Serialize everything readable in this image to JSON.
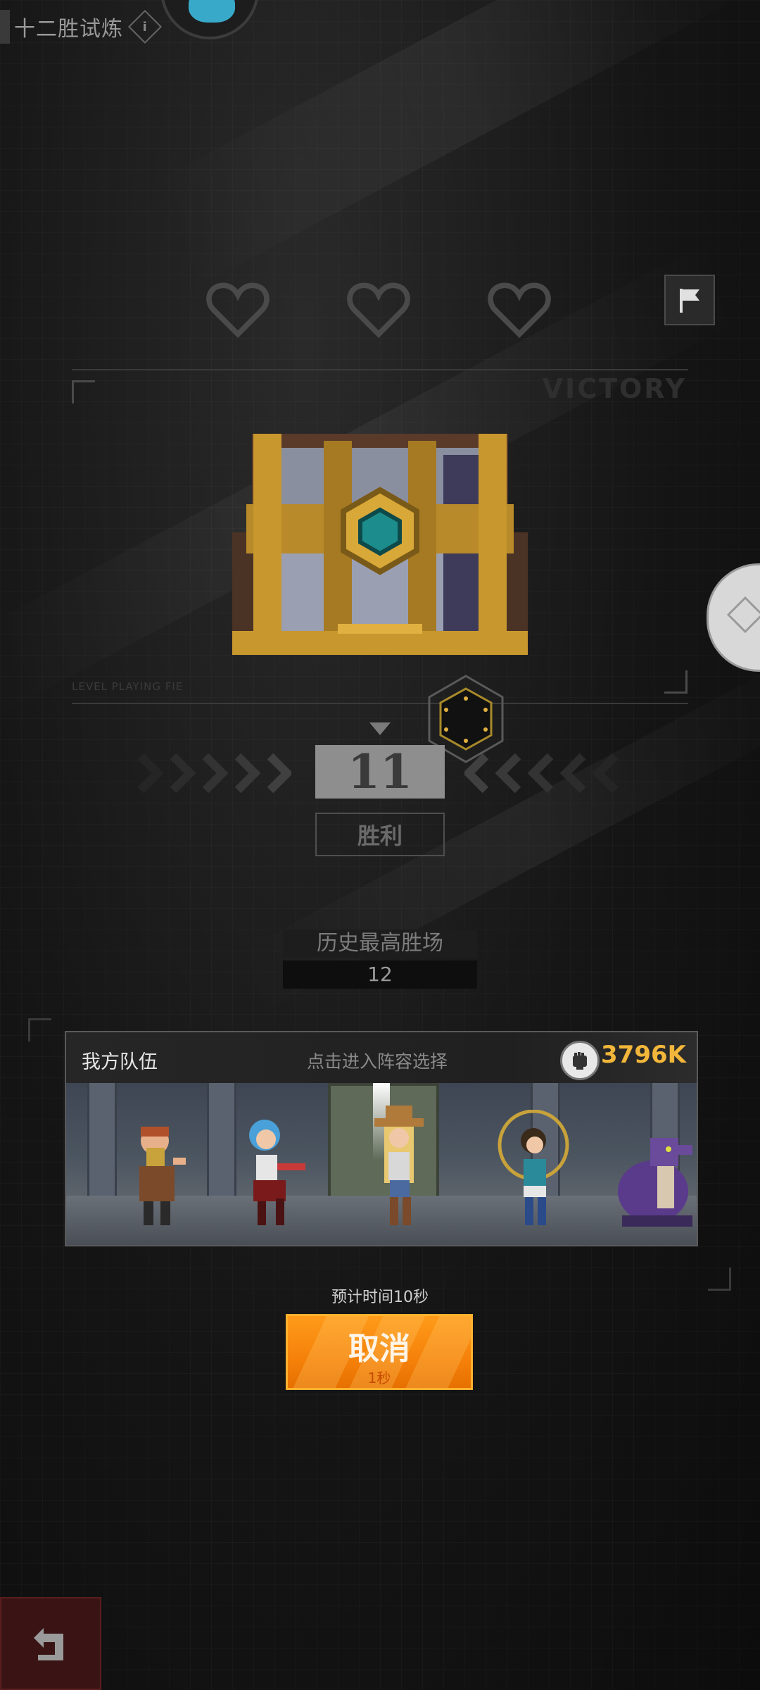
{
  "header": {
    "title": "十二胜试炼",
    "info_icon": "info-icon",
    "avatar_icon": "avatar-icon"
  },
  "lives": {
    "hearts": [
      "heart-icon",
      "heart-icon",
      "heart-icon"
    ],
    "flag_icon": "flag-icon"
  },
  "reward": {
    "victory_word": "VICTORY",
    "level_text": "LEVEL PLAYING FIE",
    "chest_icon": "treasure-chest",
    "hex_icon": "hexagon-badge"
  },
  "progress": {
    "wins": "11",
    "wins_label": "胜利",
    "best_label": "历史最高胜场",
    "best_value": "12"
  },
  "team": {
    "title": "我方队伍",
    "hint": "点击进入阵容选择",
    "power_icon": "fist-icon",
    "power_value": "3796K"
  },
  "matchmaking": {
    "estimate": "预计时间10秒",
    "cancel_label": "取消",
    "elapsed": "1秒"
  },
  "nav": {
    "back_icon": "return-icon"
  },
  "colors": {
    "accent": "#f5810a",
    "power": "#f2b73a",
    "background": "#151515"
  }
}
